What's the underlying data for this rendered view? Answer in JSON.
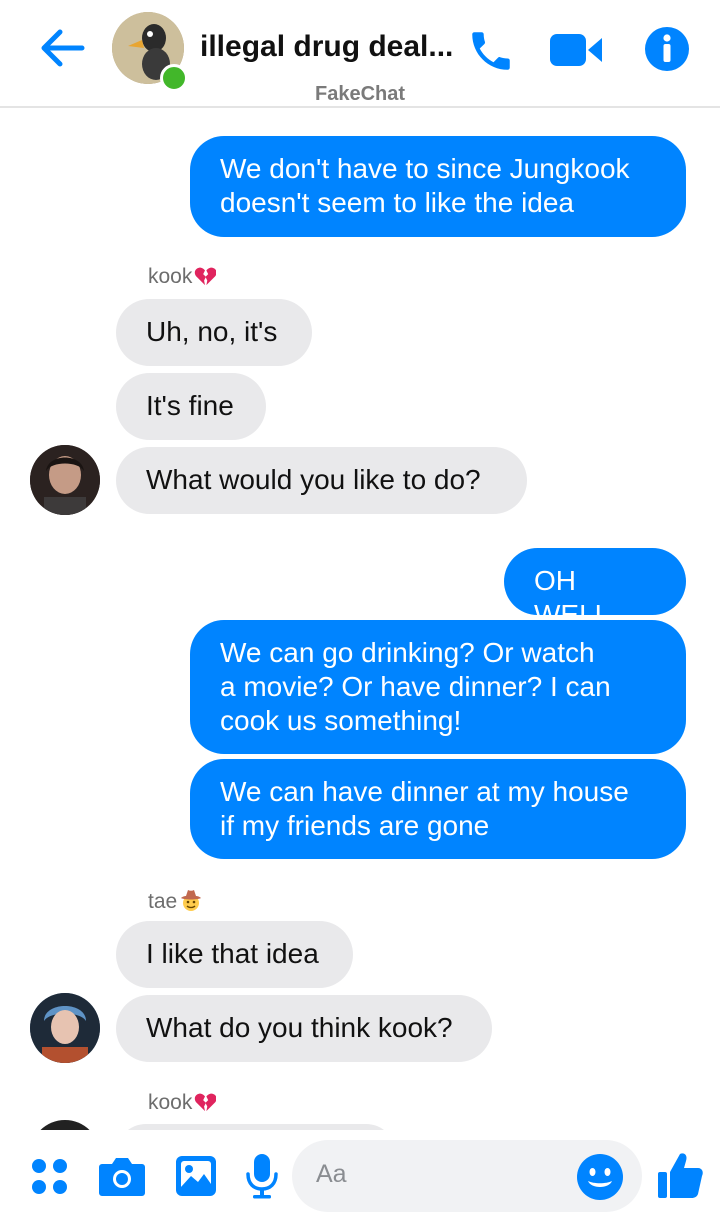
{
  "header": {
    "title": "illegal drug deal...",
    "subtitle": "FakeChat"
  },
  "messages": [
    {
      "type": "out",
      "text_lines": [
        "We don't have to since Jungkook",
        "doesn't seem to like the idea"
      ]
    },
    {
      "type": "sender",
      "name": "kook",
      "emoji": "broken-heart-icon"
    },
    {
      "type": "in",
      "text": "Uh, no, it's"
    },
    {
      "type": "in",
      "text": "It's fine"
    },
    {
      "type": "in",
      "text": "What would you like to do?"
    },
    {
      "type": "out",
      "text": "OH WELL"
    },
    {
      "type": "out",
      "text_lines": [
        "We can go drinking? Or watch",
        "a movie? Or have dinner? I can",
        "cook us something!"
      ]
    },
    {
      "type": "out",
      "text_lines": [
        "We can have dinner at my house",
        "if my friends are gone"
      ]
    },
    {
      "type": "sender",
      "name": "tae",
      "emoji": "cowboy-face-icon"
    },
    {
      "type": "in",
      "text": "I like that idea"
    },
    {
      "type": "in",
      "text": "What do you think kook?"
    },
    {
      "type": "sender",
      "name": "kook",
      "emoji": "broken-heart-icon"
    }
  ],
  "composer": {
    "placeholder": "Aa"
  },
  "colors": {
    "accent": "#0084ff",
    "incoming_bubble": "#e9e9eb",
    "online": "#42b72a"
  }
}
